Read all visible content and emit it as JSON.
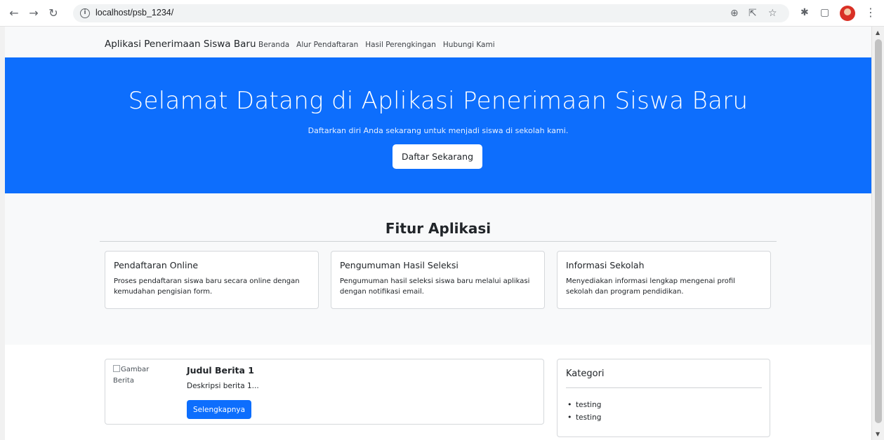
{
  "browser": {
    "url": "localhost/psb_1234/",
    "icons": [
      "back-arrow-icon",
      "forward-arrow-icon",
      "reload-icon",
      "info-icon",
      "zoom-icon",
      "share-icon",
      "star-icon",
      "puzzle-icon",
      "sidepanel-icon",
      "profile-avatar",
      "menu-dots-icon"
    ]
  },
  "navbar": {
    "brand": "Aplikasi Penerimaan Siswa Baru",
    "links": [
      "Beranda",
      "Alur Pendaftaran",
      "Hasil Perengkingan",
      "Hubungi Kami"
    ]
  },
  "hero": {
    "title": "Selamat Datang di Aplikasi Penerimaan Siswa Baru",
    "subtitle": "Daftarkan diri Anda sekarang untuk menjadi siswa di sekolah kami.",
    "button": "Daftar Sekarang",
    "background": "#0d6efd"
  },
  "features": {
    "title": "Fitur Aplikasi",
    "cards": [
      {
        "title": "Pendaftaran Online",
        "text": "Proses pendaftaran siswa baru secara online dengan kemudahan pengisian form."
      },
      {
        "title": "Pengumuman Hasil Seleksi",
        "text": "Pengumuman hasil seleksi siswa baru melalui aplikasi dengan notifikasi email."
      },
      {
        "title": "Informasi Sekolah",
        "text": "Menyediakan informasi lengkap mengenai profil sekolah dan program pendidikan."
      }
    ]
  },
  "news": {
    "image_alt": "Gambar Berita",
    "title": "Judul Berita 1",
    "description": "Deskripsi berita 1...",
    "button": "Selengkapnya"
  },
  "categories": {
    "title": "Kategori",
    "items": [
      "testing",
      "testing"
    ]
  }
}
